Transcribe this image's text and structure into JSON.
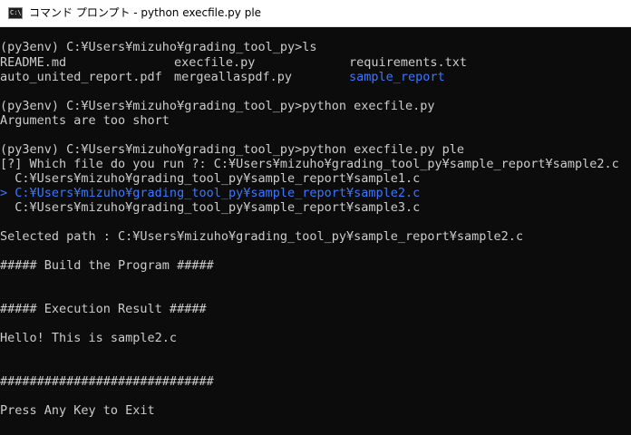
{
  "window": {
    "icon_text": "C:\\",
    "title": "コマンド プロンプト - python  execfile.py ple"
  },
  "colors": {
    "background": "#0c0c0c",
    "text": "#cccccc",
    "highlight": "#3b78ff"
  },
  "console": {
    "prompt1": "(py3env) C:¥Users¥mizuho¥grading_tool_py>ls",
    "ls": [
      [
        "README.md",
        "execfile.py",
        "requirements.txt"
      ],
      [
        "auto_united_report.pdf",
        "mergeallaspdf.py",
        "sample_report"
      ]
    ],
    "prompt2": "(py3env) C:¥Users¥mizuho¥grading_tool_py>python execfile.py",
    "error": "Arguments are too short",
    "prompt3": "(py3env) C:¥Users¥mizuho¥grading_tool_py>python execfile.py ple",
    "question": "[?] Which file do you run ?: C:¥Users¥mizuho¥grading_tool_py¥sample_report¥sample2.c",
    "options": [
      "  C:¥Users¥mizuho¥grading_tool_py¥sample_report¥sample1.c",
      "> C:¥Users¥mizuho¥grading_tool_py¥sample_report¥sample2.c",
      "  C:¥Users¥mizuho¥grading_tool_py¥sample_report¥sample3.c"
    ],
    "selected": "Selected path : C:¥Users¥mizuho¥grading_tool_py¥sample_report¥sample2.c",
    "build": "##### Build the Program #####",
    "exec": "##### Execution Result #####",
    "output": "Hello! This is sample2.c",
    "hashes": "#############################",
    "press": "Press Any Key to Exit"
  }
}
